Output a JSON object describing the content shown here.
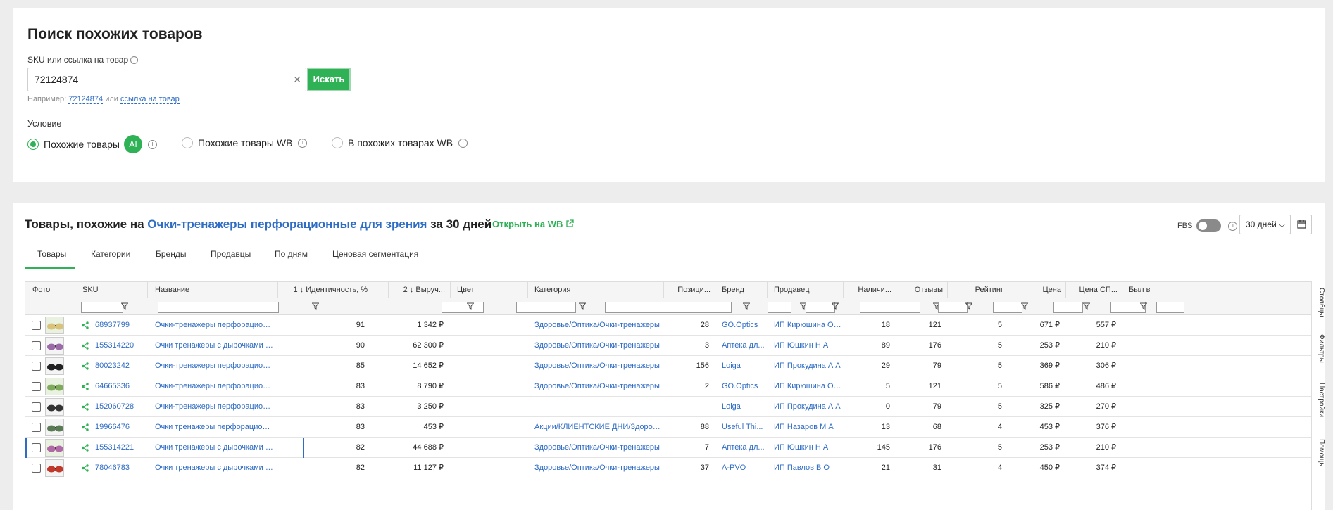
{
  "search": {
    "title": "Поиск похожих товаров",
    "field_label": "SKU или ссылка на товар",
    "value": "72124874",
    "button": "Искать",
    "example_prefix": "Например:",
    "example_sku": "72124874",
    "example_or": "или",
    "example_link": "ссылка на товар",
    "condition_label": "Условие",
    "options": [
      {
        "label": "Похожие товары",
        "selected": true,
        "badge": "AI"
      },
      {
        "label": "Похожие товары WB",
        "selected": false
      },
      {
        "label": "В похожих товарах WB",
        "selected": false
      }
    ]
  },
  "results": {
    "title_prefix": "Товары, похожие на",
    "title_link": "Очки-тренажеры перфорационные для зрения",
    "title_suffix": "за 30 дней",
    "open_wb": "Открыть на WB",
    "fbs_label": "FBS",
    "period": "30 дней",
    "tabs": [
      "Товары",
      "Категории",
      "Бренды",
      "Продавцы",
      "По дням",
      "Ценовая сегментация"
    ],
    "columns": [
      "Фото",
      "SKU",
      "Название",
      "1",
      "Идентичность, %",
      "2",
      "Выруч...",
      "Цвет",
      "Категория",
      "Позици...",
      "Бренд",
      "Продавец",
      "Наличи...",
      "Отзывы",
      "Рейтинг",
      "Цена",
      "Цена СП...",
      "Был в"
    ],
    "side_tabs": [
      "Столбцы",
      "Фильтры",
      "Настройки",
      "Помощь"
    ],
    "rows": [
      {
        "sku": "68937799",
        "name": "Очки-тренажеры перфорационн...",
        "ident": "91",
        "revenue": "1 342 ₽",
        "category": "Здоровье/Оптика/Очки-тренажеры",
        "pos": "28",
        "brand": "GO.Optics",
        "seller": "ИП Кирюшина О Ю",
        "stock": "18",
        "reviews": "121",
        "rating": "5",
        "price": "671 ₽",
        "price_spp": "557 ₽"
      },
      {
        "sku": "155314220",
        "name": "Очки тренажеры с дырочками пе...",
        "ident": "90",
        "revenue": "62 300 ₽",
        "category": "Здоровье/Оптика/Очки-тренажеры",
        "pos": "3",
        "brand": "Аптека дл...",
        "seller": "ИП Юшкин Н А",
        "stock": "89",
        "reviews": "176",
        "rating": "5",
        "price": "253 ₽",
        "price_spp": "210 ₽"
      },
      {
        "sku": "80023242",
        "name": "Очки-тренажеры перфорационные",
        "ident": "85",
        "revenue": "14 652 ₽",
        "category": "Здоровье/Оптика/Очки-тренажеры",
        "pos": "156",
        "brand": "Loiga",
        "seller": "ИП Прокудина А А",
        "stock": "29",
        "reviews": "79",
        "rating": "5",
        "price": "369 ₽",
        "price_spp": "306 ₽"
      },
      {
        "sku": "64665336",
        "name": "Очки-тренажеры перфорационн...",
        "ident": "83",
        "revenue": "8 790 ₽",
        "category": "Здоровье/Оптика/Очки-тренажеры",
        "pos": "2",
        "brand": "GO.Optics",
        "seller": "ИП Кирюшина О Ю",
        "stock": "5",
        "reviews": "121",
        "rating": "5",
        "price": "586 ₽",
        "price_spp": "486 ₽"
      },
      {
        "sku": "152060728",
        "name": "Очки-тренажеры перфорационные",
        "ident": "83",
        "revenue": "3 250 ₽",
        "category": "",
        "pos": "",
        "brand": "Loiga",
        "seller": "ИП Прокудина А А",
        "stock": "0",
        "reviews": "79",
        "rating": "5",
        "price": "325 ₽",
        "price_spp": "270 ₽"
      },
      {
        "sku": "19966476",
        "name": "Очки тренажеры перфорационные",
        "ident": "83",
        "revenue": "453 ₽",
        "category": "Акции/КЛИЕНТСКИЕ ДНИ/Здоровье/...",
        "pos": "88",
        "brand": "Useful Thi...",
        "seller": "ИП Назаров М А",
        "stock": "13",
        "reviews": "68",
        "rating": "4",
        "price": "453 ₽",
        "price_spp": "376 ₽"
      },
      {
        "sku": "155314221",
        "name": "Очки тренажеры с дырочками пе...",
        "ident": "82",
        "revenue": "44 688 ₽",
        "category": "Здоровье/Оптика/Очки-тренажеры",
        "pos": "7",
        "brand": "Аптека дл...",
        "seller": "ИП Юшкин Н А",
        "stock": "145",
        "reviews": "176",
        "rating": "5",
        "price": "253 ₽",
        "price_spp": "210 ₽"
      },
      {
        "sku": "78046783",
        "name": "Очки тренажеры с дырочками пе...",
        "ident": "82",
        "revenue": "11 127 ₽",
        "category": "Здоровье/Оптика/Очки-тренажеры",
        "pos": "37",
        "brand": "A-PVO",
        "seller": "ИП Павлов В О",
        "stock": "21",
        "reviews": "31",
        "rating": "4",
        "price": "450 ₽",
        "price_spp": "374 ₽"
      }
    ]
  }
}
